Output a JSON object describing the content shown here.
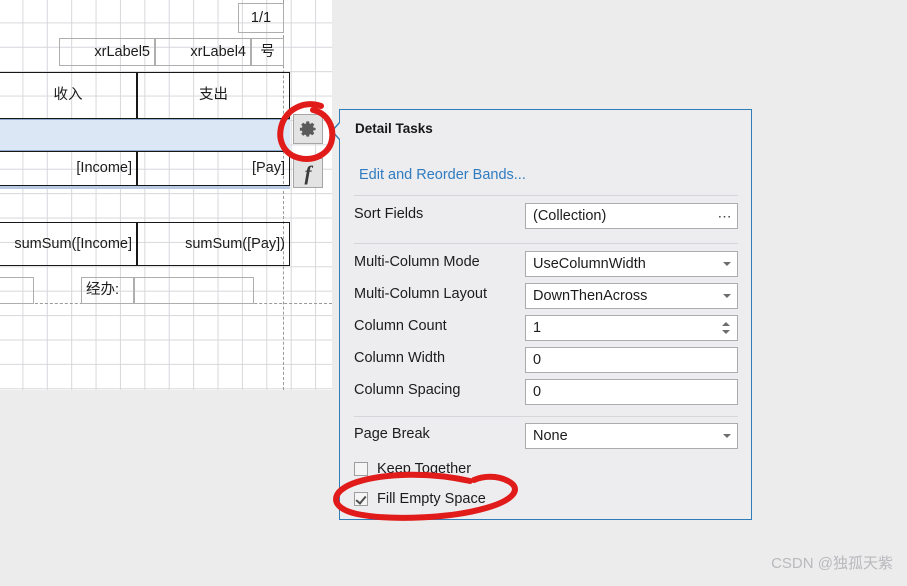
{
  "designer": {
    "page_indicator": "1/1",
    "labels": [
      {
        "name": "xrLabel5",
        "text": "xrLabel5"
      },
      {
        "name": "xrLabel4",
        "text": "xrLabel4"
      },
      {
        "name": "unit-hao",
        "text": "号"
      }
    ],
    "column_headers": [
      {
        "text": "收入"
      },
      {
        "text": "支出"
      }
    ],
    "detail_fields": [
      {
        "text": "[Income]"
      },
      {
        "text": "[Pay]"
      }
    ],
    "summary_fields": [
      {
        "text": "sumSum([Income]"
      },
      {
        "text": "sumSum([Pay])"
      }
    ],
    "footer": {
      "handler_label": "经办:",
      "handler_value": ""
    },
    "smart_tag": {
      "gear_icon": "gear-icon",
      "fx_icon": "fx-icon",
      "fx_glyph": "f"
    }
  },
  "tasks_panel": {
    "title": "Detail Tasks",
    "edit_bands_link": "Edit and Reorder Bands...",
    "rows": [
      {
        "label": "Sort Fields",
        "value": "(Collection)",
        "control": "ellipsis",
        "control_glyph": "⋯"
      },
      {
        "label": "Multi-Column Mode",
        "value": "UseColumnWidth",
        "control": "combo"
      },
      {
        "label": "Multi-Column Layout",
        "value": "DownThenAcross",
        "control": "combo"
      },
      {
        "label": "Column Count",
        "value": "1",
        "control": "spinner"
      },
      {
        "label": "Column Width",
        "value": "0",
        "control": "text"
      },
      {
        "label": "Column Spacing",
        "value": "0",
        "control": "text"
      },
      {
        "label": "Page Break",
        "value": "None",
        "control": "combo"
      }
    ],
    "checkboxes": [
      {
        "label": "Keep Together",
        "checked": false
      },
      {
        "label": "Fill Empty Space",
        "checked": true
      }
    ]
  },
  "annotation": {
    "color": "#e01b19",
    "circle_gear": "circle-around-gear-icon",
    "ellipse_fill_empty_space": "ellipse-around-fill-empty-space"
  },
  "watermark": {
    "text": "CSDN @独孤天紫"
  },
  "colors": {
    "panel_border": "#2e7cb8",
    "panel_bg": "#edecef",
    "link": "#2f7cc0",
    "selection": "#dce7f6",
    "accent_red": "#e01b19",
    "db_marker": "#f0922c"
  }
}
